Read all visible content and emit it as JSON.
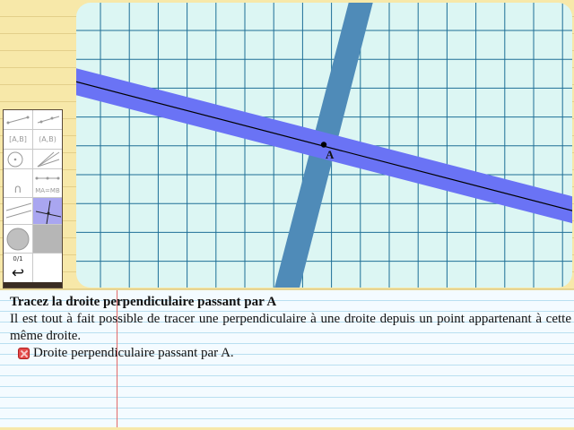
{
  "board": {
    "point_label": "A",
    "colors": {
      "background": "#dcf6f3",
      "grid_line": "#1e6f96",
      "band_blue": "#6a73f5",
      "band_steel": "#4f8bb8",
      "line": "#000000"
    }
  },
  "toolbar": {
    "tools": [
      {
        "name": "segment-tool",
        "label": ""
      },
      {
        "name": "ray-tool",
        "label": ""
      },
      {
        "name": "segment-notation-tool",
        "label": "[A,B]"
      },
      {
        "name": "ray-notation-tool",
        "label": "(A,B)"
      },
      {
        "name": "circle-tool",
        "label": ""
      },
      {
        "name": "lines-tool",
        "label": ""
      },
      {
        "name": "arc-tool",
        "label": "∩"
      },
      {
        "name": "midpoint-tool",
        "label": "MA=MB"
      },
      {
        "name": "perpendicular-tool",
        "label": ""
      },
      {
        "name": "parallel-tool",
        "label": ""
      },
      {
        "name": "disk-tool",
        "label": ""
      },
      {
        "name": "grey-tool",
        "label": ""
      },
      {
        "name": "counter",
        "label": "0/1"
      },
      {
        "name": "blank-tool",
        "label": ""
      },
      {
        "name": "undo-tool",
        "label": "↩"
      },
      {
        "name": "blank-tool-2",
        "label": ""
      }
    ]
  },
  "exercise": {
    "title": "Tracez la droite perpendiculaire passant par A",
    "description": "Il est tout à fait possible de tracer une perpendiculaire à une droite depuis un point appartenant à cette même droite.",
    "task": "Droite perpendiculaire passant par A."
  }
}
